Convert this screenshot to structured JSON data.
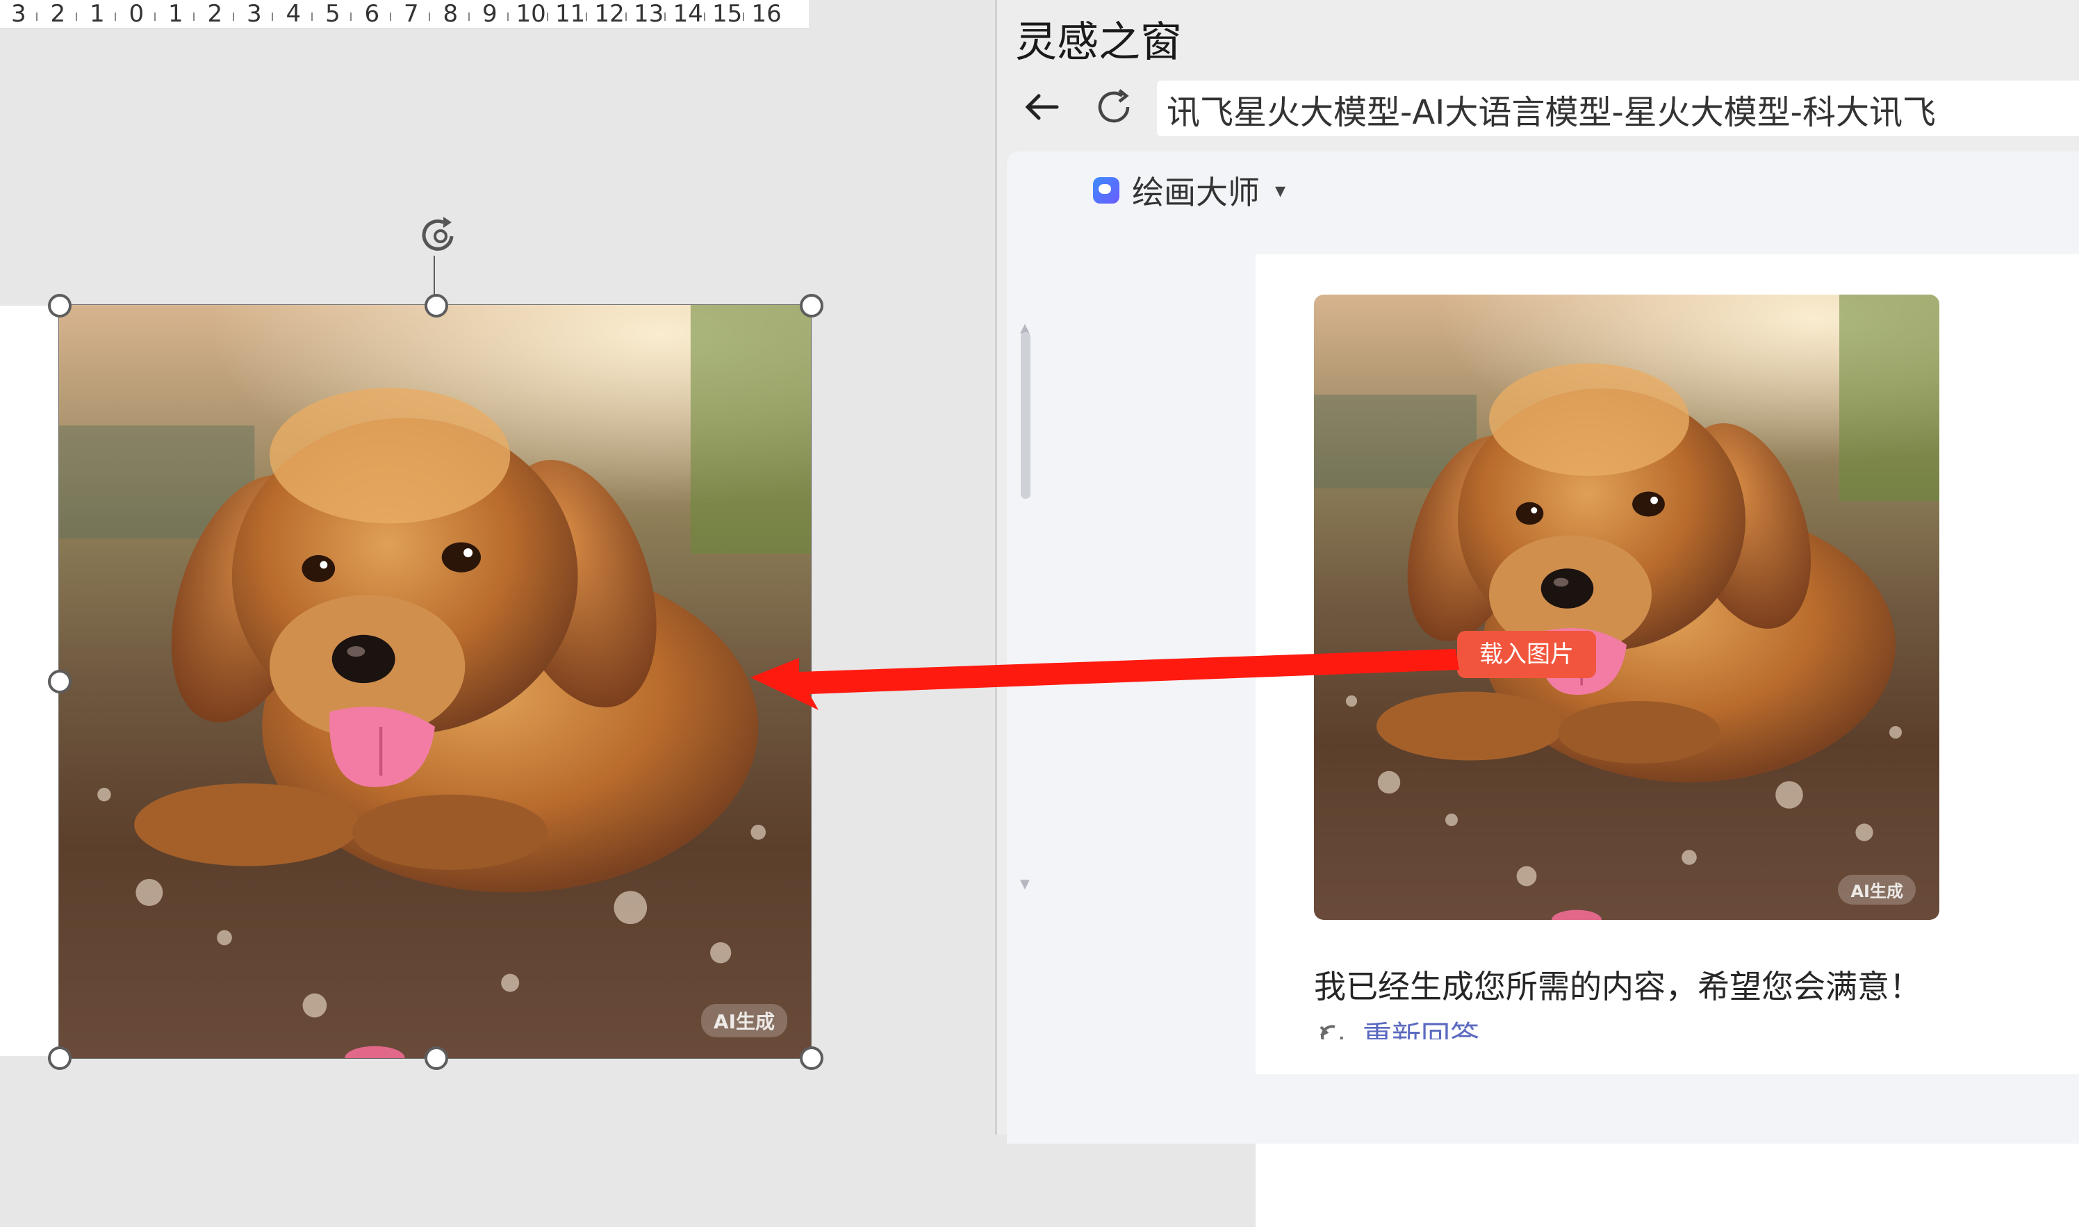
{
  "ruler": {
    "labels": [
      "3",
      "2",
      "1",
      "0",
      "1",
      "2",
      "3",
      "4",
      "5",
      "6",
      "7",
      "8",
      "9",
      "10",
      "11",
      "12",
      "13",
      "14",
      "15",
      "16"
    ]
  },
  "slide": {
    "image_description_icon": "puppy-image",
    "watermark": "AI生成"
  },
  "window": {
    "title": "灵感之窗",
    "back_icon": "arrow-left-icon",
    "refresh_icon": "refresh-icon",
    "url": "讯飞星火大模型-AI大语言模型-星火大模型-科大讯飞"
  },
  "chat": {
    "model_name": "绘画大师",
    "model_caret": "▾",
    "image_watermark": "AI生成",
    "load_image_button": "载入图片",
    "reply": "我已经生成您所需的内容，希望您会满意！",
    "regenerate": "重新回答"
  },
  "colors": {
    "accent_red": "#f2553d",
    "arrow_red": "#ff1a10",
    "link_blue": "#5c6bc0"
  }
}
